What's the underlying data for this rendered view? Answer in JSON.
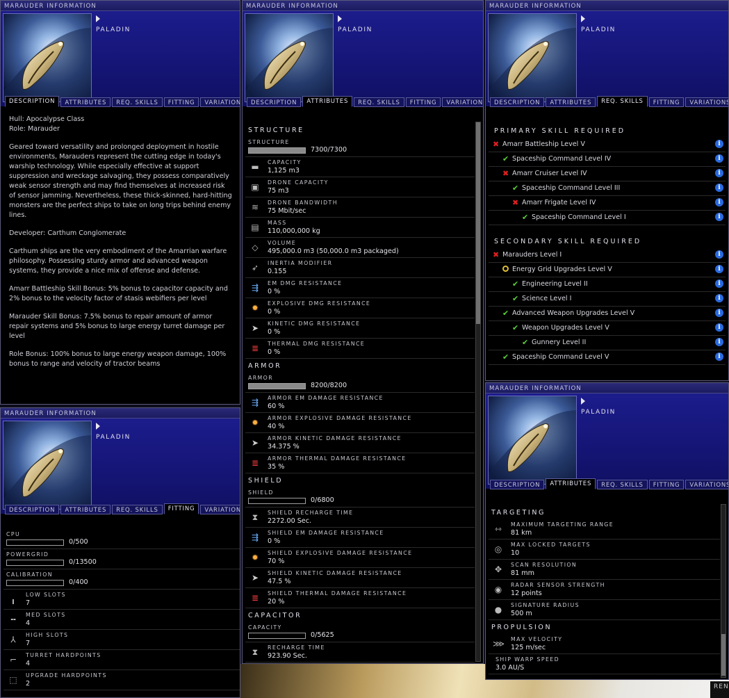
{
  "common": {
    "window_title": "MARAUDER INFORMATION",
    "ship_name": "PALADIN",
    "tabs": {
      "description": "DESCRIPTION",
      "attributes": "ATTRIBUTES",
      "req_skills": "REQ. SKILLS",
      "fitting": "FITTING",
      "variations": "VARIATIONS"
    }
  },
  "description": {
    "p1a": "Hull: Apocalypse Class",
    "p1b": "Role: Marauder",
    "p2": "Geared toward versatility and prolonged deployment in hostile environments, Marauders represent the cutting edge in today's warship technology. While especially effective at support suppression and wreckage salvaging, they possess comparatively weak sensor strength and may find themselves at increased risk of sensor jamming. Nevertheless, these thick-skinned, hard-hitting monsters are the perfect ships to take on long trips behind enemy lines.",
    "p3": "Developer: Carthum Conglomerate",
    "p4": "Carthum ships are the very embodiment of the Amarrian warfare philosophy. Possessing sturdy armor and advanced weapon systems, they provide a nice mix of offense and defense.",
    "p5": "Amarr Battleship Skill Bonus: 5% bonus to capacitor capacity and 2% bonus to the velocity factor of stasis webifiers per level",
    "p6": "Marauder Skill Bonus: 7.5% bonus to repair amount of armor repair systems and 5% bonus to large energy turret damage per level",
    "p7": "Role Bonus: 100% bonus to large energy weapon damage, 100% bonus to range and velocity of tractor beams"
  },
  "attributes": {
    "structure_header": "STRUCTURE",
    "structure": {
      "label": "STRUCTURE",
      "value": "7300/7300",
      "fill": 1.0
    },
    "rows1": [
      {
        "label": "CAPACITY",
        "value": "1,125 m3",
        "icon": "cargo-icon"
      },
      {
        "label": "DRONE CAPACITY",
        "value": "75 m3",
        "icon": "drone-bay-icon"
      },
      {
        "label": "DRONE BANDWIDTH",
        "value": "75 Mbit/sec",
        "icon": "drone-bandwidth-icon"
      },
      {
        "label": "MASS",
        "value": "110,000,000 kg",
        "icon": "mass-icon"
      },
      {
        "label": "VOLUME",
        "value": "495,000.0 m3 (50,000.0 m3 packaged)",
        "icon": "volume-icon"
      },
      {
        "label": "INERTIA MODIFIER",
        "value": "0.155",
        "icon": "inertia-icon"
      },
      {
        "label": "EM DMG RESISTANCE",
        "value": "0 %",
        "icon": "em-resist-icon"
      },
      {
        "label": "EXPLOSIVE DMG RESISTANCE",
        "value": "0 %",
        "icon": "explosive-resist-icon"
      },
      {
        "label": "KINETIC DMG RESISTANCE",
        "value": "0 %",
        "icon": "kinetic-resist-icon"
      },
      {
        "label": "THERMAL DMG RESISTANCE",
        "value": "0 %",
        "icon": "thermal-resist-icon"
      }
    ],
    "armor_header": "ARMOR",
    "armor": {
      "label": "ARMOR",
      "value": "8200/8200",
      "fill": 1.0
    },
    "rows2": [
      {
        "label": "ARMOR EM DAMAGE RESISTANCE",
        "value": "60 %",
        "icon": "em-resist-icon"
      },
      {
        "label": "ARMOR EXPLOSIVE DAMAGE RESISTANCE",
        "value": "40 %",
        "icon": "explosive-resist-icon"
      },
      {
        "label": "ARMOR KINETIC DAMAGE RESISTANCE",
        "value": "34.375 %",
        "icon": "kinetic-resist-icon"
      },
      {
        "label": "ARMOR THERMAL DAMAGE RESISTANCE",
        "value": "35 %",
        "icon": "thermal-resist-icon"
      }
    ],
    "shield_header": "SHIELD",
    "shield": {
      "label": "SHIELD",
      "value": "0/6800",
      "fill": 0
    },
    "rows3": [
      {
        "label": "SHIELD RECHARGE TIME",
        "value": "2272.00 Sec.",
        "icon": "hourglass-icon"
      },
      {
        "label": "SHIELD EM DAMAGE RESISTANCE",
        "value": "0 %",
        "icon": "em-resist-icon"
      },
      {
        "label": "SHIELD EXPLOSIVE DAMAGE RESISTANCE",
        "value": "70 %",
        "icon": "explosive-resist-icon"
      },
      {
        "label": "SHIELD KINETIC DAMAGE RESISTANCE",
        "value": "47.5 %",
        "icon": "kinetic-resist-icon"
      },
      {
        "label": "SHIELD THERMAL DAMAGE RESISTANCE",
        "value": "20 %",
        "icon": "thermal-resist-icon"
      }
    ],
    "capacitor_header": "CAPACITOR",
    "capacitor": {
      "label": "CAPACITY",
      "value": "0/5625",
      "fill": 0
    },
    "rows4": [
      {
        "label": "RECHARGE TIME",
        "value": "923.90 Sec.",
        "icon": "hourglass-icon"
      }
    ]
  },
  "skills": {
    "primary_header": "PRIMARY SKILL REQUIRED",
    "primary": [
      {
        "name": "Amarr Battleship Level V",
        "status": "missing",
        "depth": 0
      },
      {
        "name": "Spaceship Command Level IV",
        "status": "trained",
        "depth": 1
      },
      {
        "name": "Amarr Cruiser Level IV",
        "status": "missing",
        "depth": 1
      },
      {
        "name": "Spaceship Command Level III",
        "status": "trained",
        "depth": 2
      },
      {
        "name": "Amarr Frigate Level IV",
        "status": "missing",
        "depth": 2
      },
      {
        "name": "Spaceship Command Level I",
        "status": "trained",
        "depth": 3
      }
    ],
    "secondary_header": "SECONDARY SKILL REQUIRED",
    "secondary": [
      {
        "name": "Marauders Level I",
        "status": "missing",
        "depth": 0
      },
      {
        "name": "Energy Grid Upgrades Level V",
        "status": "partial",
        "depth": 1
      },
      {
        "name": "Engineering Level II",
        "status": "trained",
        "depth": 2
      },
      {
        "name": "Science Level I",
        "status": "trained",
        "depth": 2
      },
      {
        "name": "Advanced Weapon Upgrades Level V",
        "status": "trained",
        "depth": 1
      },
      {
        "name": "Weapon Upgrades Level V",
        "status": "trained",
        "depth": 2
      },
      {
        "name": "Gunnery Level II",
        "status": "trained",
        "depth": 3
      },
      {
        "name": "Spaceship Command Level V",
        "status": "trained",
        "depth": 1
      }
    ]
  },
  "fitting": {
    "bars": [
      {
        "label": "CPU",
        "value": "0/500",
        "fill": 0
      },
      {
        "label": "POWERGRID",
        "value": "0/13500",
        "fill": 0
      },
      {
        "label": "CALIBRATION",
        "value": "0/400",
        "fill": 0
      }
    ],
    "rows": [
      {
        "label": "LOW SLOTS",
        "value": "7",
        "icon": "low-slot-icon"
      },
      {
        "label": "MED SLOTS",
        "value": "4",
        "icon": "med-slot-icon"
      },
      {
        "label": "HIGH SLOTS",
        "value": "7",
        "icon": "high-slot-icon"
      },
      {
        "label": "TURRET HARDPOINTS",
        "value": "4",
        "icon": "turret-icon"
      },
      {
        "label": "UPGRADE HARDPOINTS",
        "value": "2",
        "icon": "upgrade-icon"
      }
    ]
  },
  "targeting": {
    "targeting_header": "TARGETING",
    "rows1": [
      {
        "label": "MAXIMUM TARGETING RANGE",
        "value": "81 km",
        "icon": "targeting-range-icon"
      },
      {
        "label": "MAX LOCKED TARGETS",
        "value": "10",
        "icon": "locked-targets-icon"
      },
      {
        "label": "SCAN RESOLUTION",
        "value": "81 mm",
        "icon": "scan-resolution-icon"
      },
      {
        "label": "RADAR SENSOR STRENGTH",
        "value": "12 points",
        "icon": "radar-icon"
      },
      {
        "label": "SIGNATURE RADIUS",
        "value": "500 m",
        "icon": "signature-icon"
      }
    ],
    "propulsion_header": "PROPULSION",
    "rows2": [
      {
        "label": "MAX VELOCITY",
        "value": "125 m/sec",
        "icon": "velocity-icon"
      }
    ],
    "warp": {
      "label": "SHIP WARP SPEED",
      "value": "3.0 AU/S"
    }
  },
  "ren_label": "REN",
  "status_icons": {
    "missing": "✖",
    "trained": "✔"
  },
  "info_icon_label": "i",
  "colors": {
    "panel_blue": "#15157a",
    "missing": "#e02020",
    "trained": "#58d038",
    "partial": "#e0c030",
    "info": "#2a6adf"
  }
}
